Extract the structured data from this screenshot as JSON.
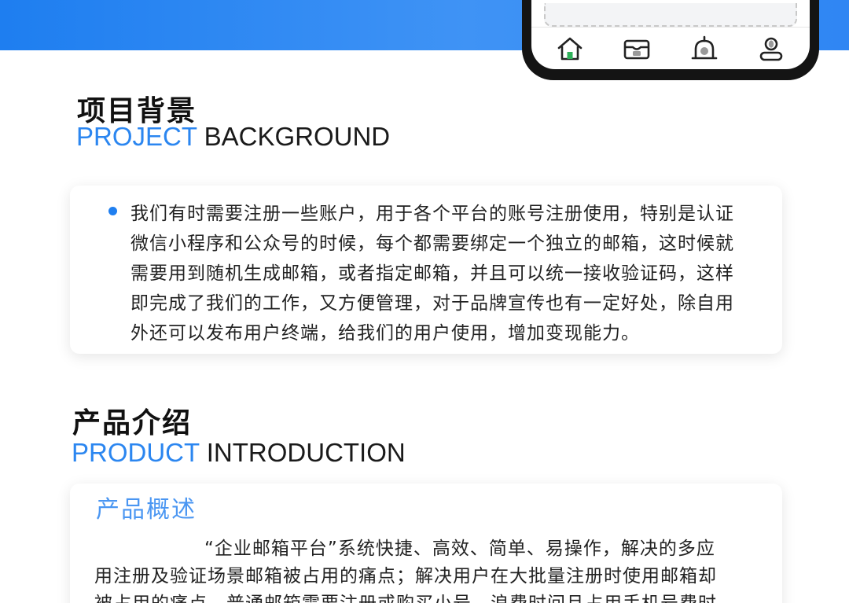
{
  "sections": {
    "background": {
      "title_cn": "项目背景",
      "title_en_accent": "PROJECT",
      "title_en_rest": "BACKGROUND",
      "lines": [
        "我们有时需要注册一些账户，用于各个平台的账号注册使用，特别是认证",
        "微信小程序和公众号的时候，每个都需要绑定一个独立的邮箱，这时候就",
        "需要用到随机生成邮箱，或者指定邮箱，并且可以统一接收验证码，这样",
        "即完成了我们的工作，又方便管理，对于品牌宣传也有一定好处，除自用",
        "外还可以发布用户终端，给我们的用户使用，增加变现能力。"
      ]
    },
    "introduction": {
      "title_cn": "产品介绍",
      "title_en_accent": "PRODUCT",
      "title_en_rest": "INTRODUCTION",
      "overview_title": "产品概述",
      "lines": [
        "“企业邮箱平台”系统快捷、高效、简单、易操作，解决的多应",
        "用注册及验证场景邮箱被占用的痛点；解决用户在大批量注册时使用邮箱却",
        "被占用的痛点，普通邮箱需要注册或购买小号，浪费时间且占用手机号费时"
      ]
    }
  },
  "phone_tabs": [
    {
      "icon": "home-icon"
    },
    {
      "icon": "mailbox-icon"
    },
    {
      "icon": "bell-icon"
    },
    {
      "icon": "user-icon"
    }
  ],
  "colors": {
    "accent": "#2b86f0",
    "banner": "#1e7ef0",
    "overview": "#4a96f2"
  }
}
